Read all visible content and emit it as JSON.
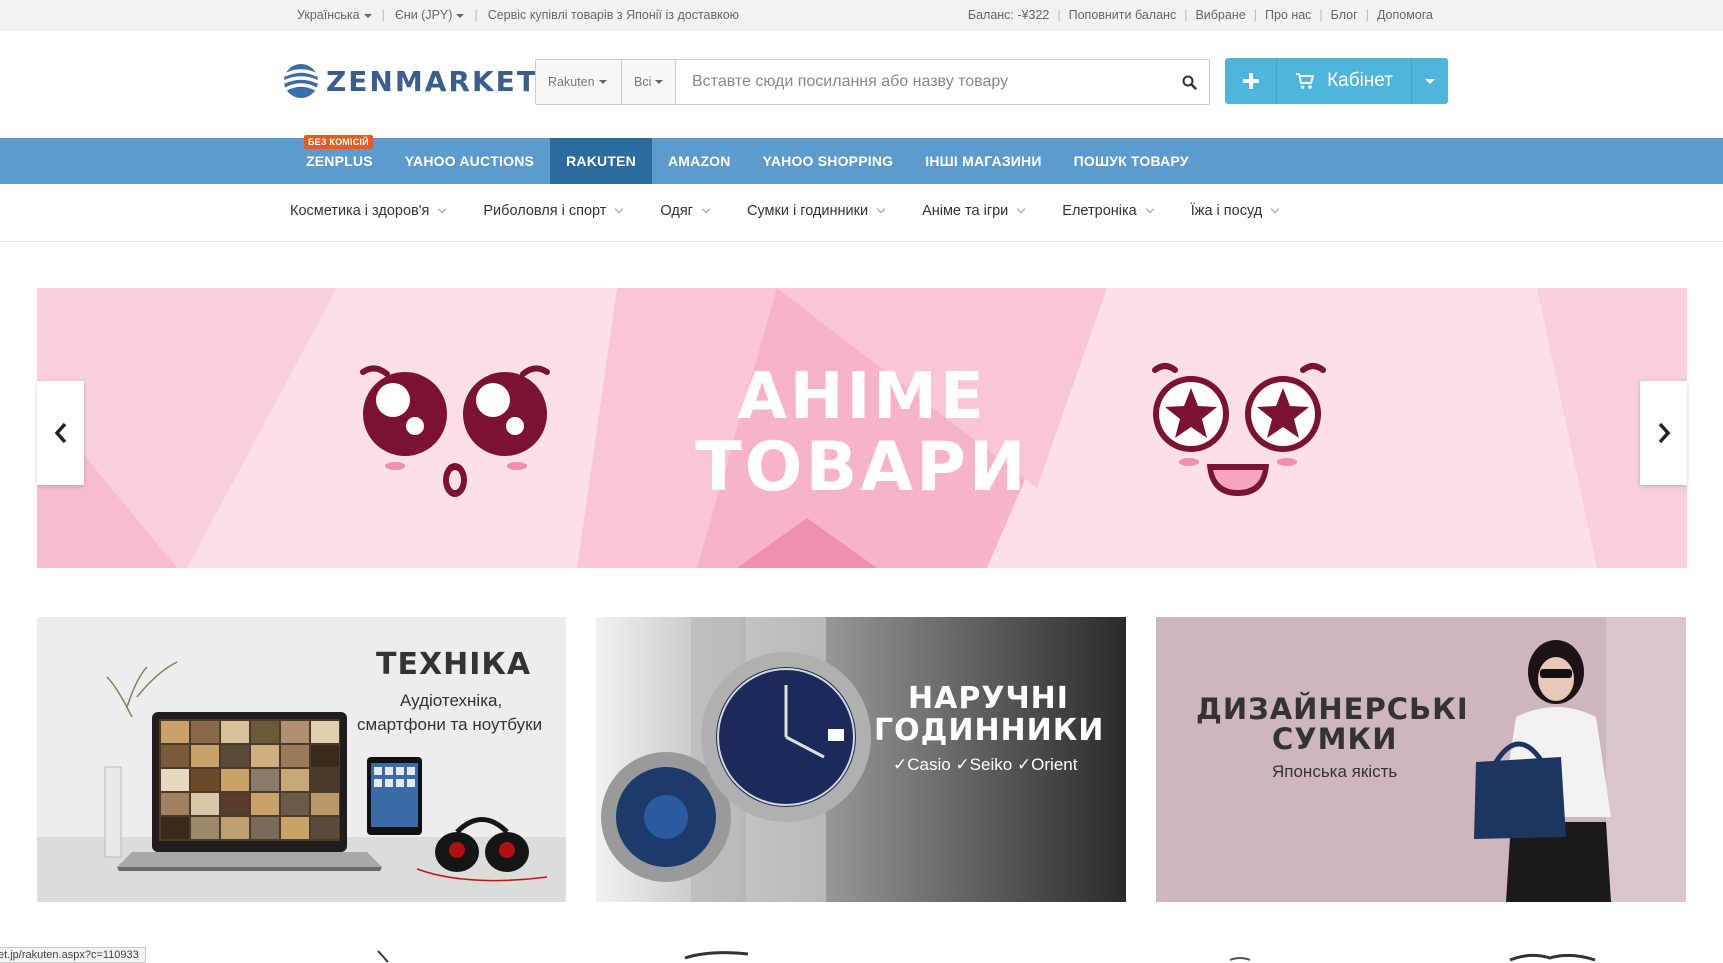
{
  "topbar": {
    "language": "Українська",
    "currency": "Єни (JPY)",
    "tagline": "Сервіс купівлі товарів з Японії із доставкою",
    "links": [
      "Баланс: -¥322",
      "Поповнити баланс",
      "Вибране",
      "Про нас",
      "Блог",
      "Допомога"
    ]
  },
  "header": {
    "logo_text": "ZENMARKET",
    "search": {
      "store_select": "Rakuten",
      "category_select": "Всі",
      "placeholder": "Вставте сюди посилання або назву товару"
    },
    "cabinet_label": "Кабінет"
  },
  "store_nav": {
    "badge": "БЕЗ КОМІСІЙ",
    "items": [
      "ZENPLUS",
      "YAHOO AUCTIONS",
      "RAKUTEN",
      "AMAZON",
      "YAHOO SHOPPING",
      "ІНШІ МАГАЗИНИ",
      "ПОШУК ТОВАРУ"
    ],
    "active": "RAKUTEN"
  },
  "category_nav": {
    "items": [
      "Косметика і здоров'я",
      "Риболовля і спорт",
      "Одяг",
      "Сумки і годинники",
      "Аніме та ігри",
      "Елетроніка",
      "Їжа і посуд"
    ]
  },
  "hero": {
    "line1": "АНІМЕ",
    "line2": "ТОВАРИ",
    "colors": {
      "bg": "#fbe0e8",
      "pink": "#f7a9c4",
      "dark": "#7a1230"
    }
  },
  "cards": [
    {
      "title": "ТЕХНІКА",
      "subtitle_line1": "Аудіотехніка,",
      "subtitle_line2": "смартфони та ноутбуки"
    },
    {
      "title_line1": "НАРУЧНІ",
      "title_line2": "ГОДИННИКИ",
      "subtitle": "✓Casio ✓Seiko ✓Orient"
    },
    {
      "title_line1": "ДИЗАЙНЕРСЬКІ",
      "title_line2": "СУМКИ",
      "subtitle": "Японська якість"
    }
  ],
  "status_bar": "et.jp/rakuten.aspx?c=110933"
}
